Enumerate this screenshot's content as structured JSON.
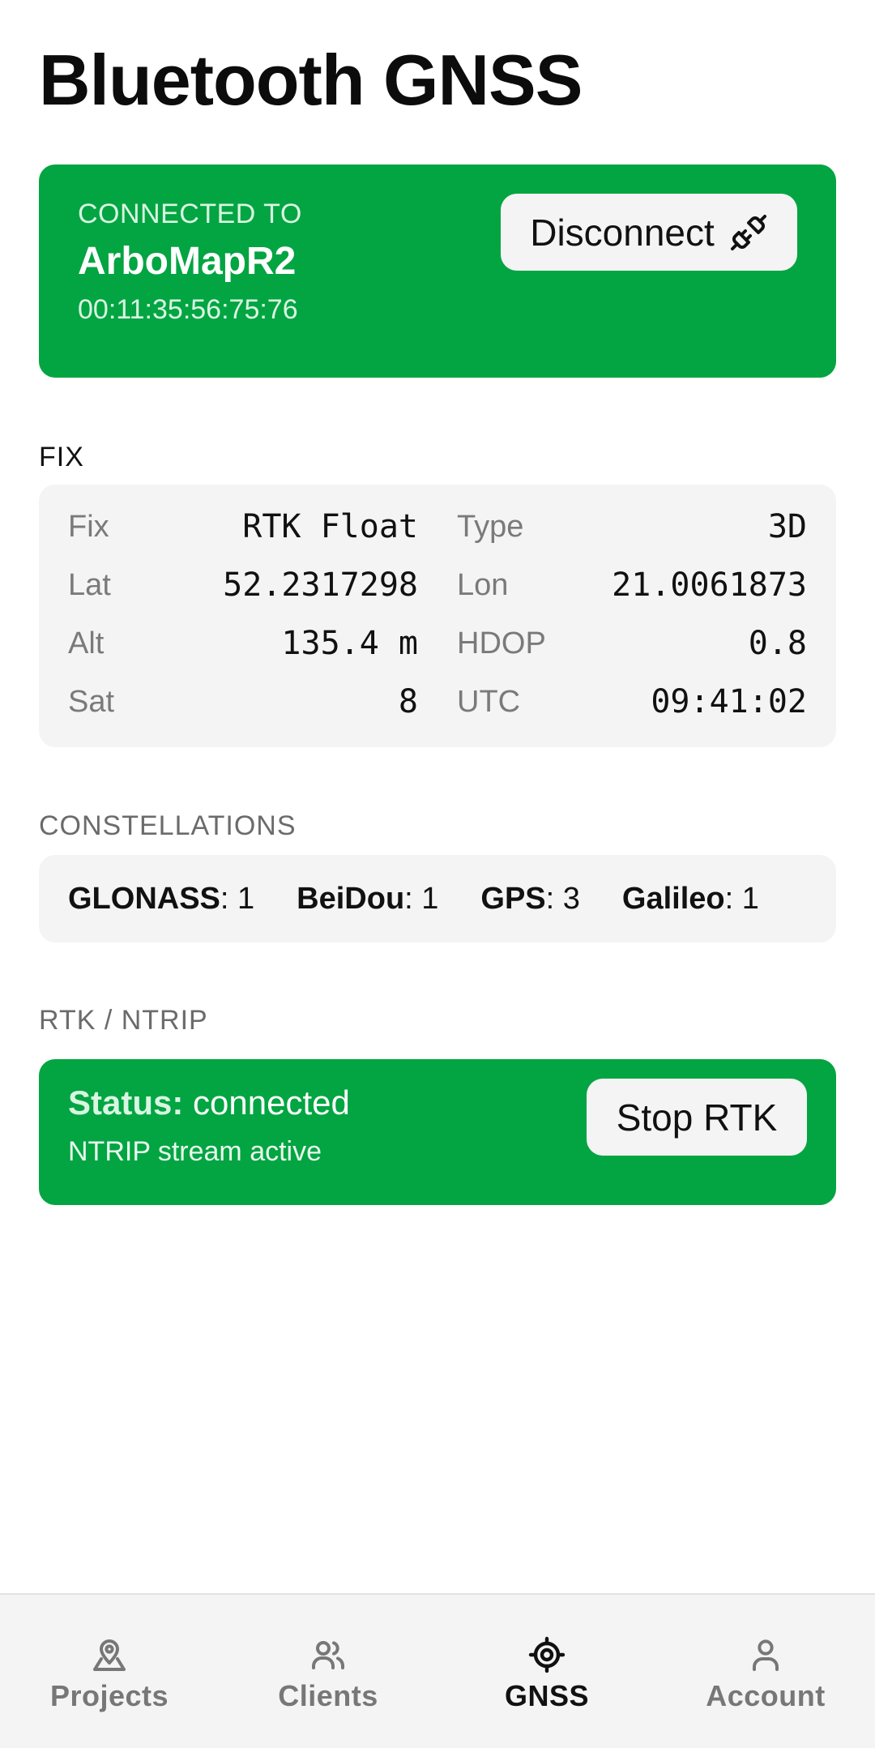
{
  "header": {
    "title": "Bluetooth GNSS"
  },
  "connection": {
    "eyebrow": "CONNECTED TO",
    "device_name": "ArboMapR2",
    "mac": "00:11:35:56:75:76",
    "disconnect_label": "Disconnect",
    "disconnect_icon": "unplug-icon",
    "card_color": "#02a541"
  },
  "fix": {
    "section_label": "FIX",
    "rows": [
      {
        "label": "Fix",
        "value": "RTK Float"
      },
      {
        "label": "Type",
        "value": "3D"
      },
      {
        "label": "Lat",
        "value": "52.2317298"
      },
      {
        "label": "Lon",
        "value": "21.0061873"
      },
      {
        "label": "Alt",
        "value": "135.4 m"
      },
      {
        "label": "HDOP",
        "value": "0.8"
      },
      {
        "label": "Sat",
        "value": "8"
      },
      {
        "label": "UTC",
        "value": "09:41:02"
      }
    ]
  },
  "constellations": {
    "section_label": "CONSTELLATIONS",
    "items": [
      {
        "name": "GLONASS",
        "count": ": 1"
      },
      {
        "name": "BeiDou",
        "count": ": 1"
      },
      {
        "name": "GPS",
        "count": ": 3"
      },
      {
        "name": "Galileo",
        "count": ": 1"
      }
    ]
  },
  "rtk": {
    "section_label": "RTK / NTRIP",
    "status_label": "Status:",
    "status_value": " connected",
    "subtitle": "NTRIP stream active",
    "stop_label": "Stop RTK"
  },
  "nav": {
    "items": [
      {
        "label": "Projects",
        "icon": "map-pin-icon",
        "active": false
      },
      {
        "label": "Clients",
        "icon": "users-icon",
        "active": false
      },
      {
        "label": "GNSS",
        "icon": "crosshair-icon",
        "active": true
      },
      {
        "label": "Account",
        "icon": "user-icon",
        "active": false
      }
    ]
  }
}
